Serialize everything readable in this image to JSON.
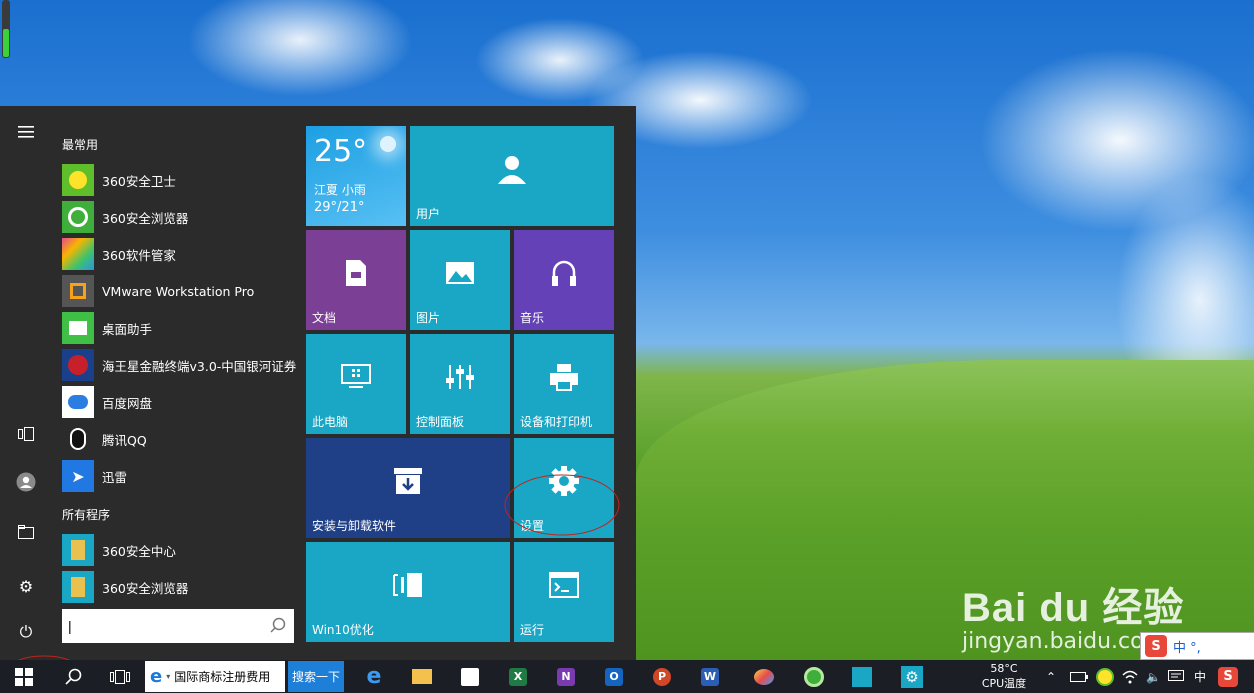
{
  "start_menu": {
    "most_used_label": "最常用",
    "all_programs_label": "所有程序",
    "most_used": [
      {
        "label": "360安全卫士",
        "icon": "360-safe-guard-icon",
        "color": "#5fbf2b"
      },
      {
        "label": "360安全浏览器",
        "icon": "360-browser-icon",
        "color": "#3fae3a"
      },
      {
        "label": "360软件管家",
        "icon": "360-software-manager-icon",
        "color": "#e84c8b"
      },
      {
        "label": "VMware Workstation Pro",
        "icon": "vmware-icon",
        "color": "#555555"
      },
      {
        "label": "桌面助手",
        "icon": "desktop-assistant-icon",
        "color": "#3fbf46"
      },
      {
        "label": "海王星金融终端v3.0-中国银河证券",
        "icon": "neptune-finance-icon",
        "color": "#c8202a"
      },
      {
        "label": "百度网盘",
        "icon": "baidu-netdisk-icon",
        "color": "#2b7de1"
      },
      {
        "label": "腾讯QQ",
        "icon": "qq-penguin-icon",
        "color": "#222222"
      },
      {
        "label": "迅雷",
        "icon": "thunder-bird-icon",
        "color": "#2178e3"
      }
    ],
    "all_programs": [
      {
        "label": "360安全中心",
        "icon": "folder-icon",
        "color": "#e8c14e"
      },
      {
        "label": "360安全浏览器",
        "icon": "folder-icon",
        "color": "#e8c14e"
      }
    ],
    "search_value": "|"
  },
  "tiles": {
    "weather": {
      "temp": "25°",
      "city": "江夏 小雨",
      "range": "29°/21°"
    },
    "user": "用户",
    "documents": "文档",
    "pictures": "图片",
    "music": "音乐",
    "this_pc": "此电脑",
    "control_panel": "控制面板",
    "devices_printers": "设备和打印机",
    "install_uninstall": "安装与卸载软件",
    "settings": "设置",
    "win10_optimize": "Win10优化",
    "run": "运行"
  },
  "taskbar": {
    "ie_tab": "国际商标注册费用",
    "search_btn": "搜索一下",
    "cpu_temp": "58°C",
    "cpu_label": "CPU温度",
    "ime": "中"
  },
  "watermark": {
    "brand": "Bai du 经验",
    "url": "jingyan.baidu.com"
  },
  "ime_bar": "中 °,",
  "colors": {
    "accent_teal": "#1aa7c6",
    "purple_tile": "#7b3f95",
    "violet_tile": "#6541b8",
    "navy_tile": "#1f3f86",
    "taskbar": "#1b1e24"
  }
}
